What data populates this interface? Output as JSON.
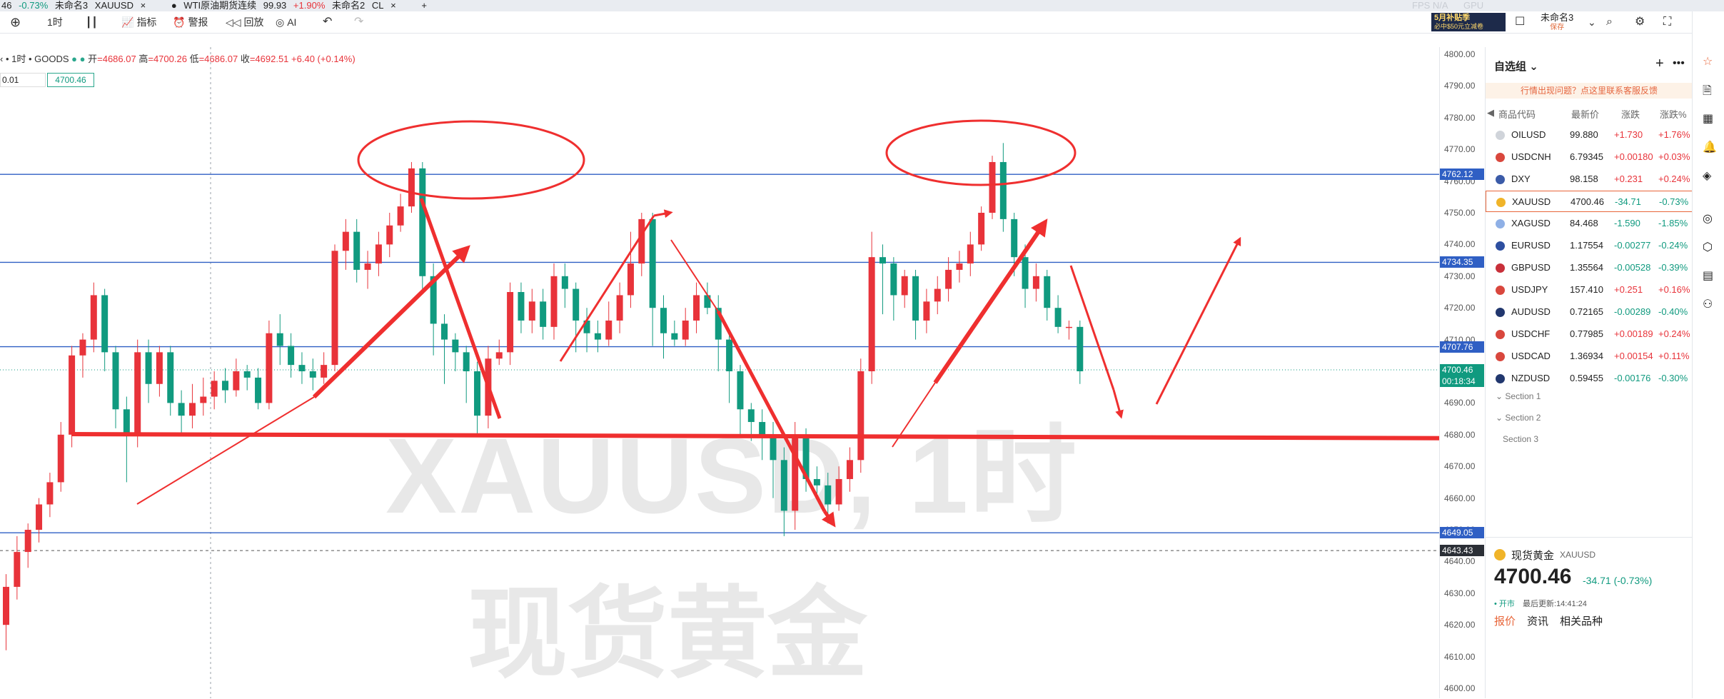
{
  "tabs": [
    {
      "pre": "46",
      "chg": "-0.73%",
      "name": "未命名3",
      "sym": "XAUUSD"
    },
    {
      "name": "WTI原油期货连续",
      "price": "99.93",
      "chg": "+1.90%",
      "ws": "未命名2",
      "sym": "CL"
    }
  ],
  "toolbar": {
    "interval": "1时",
    "indicators": "指标",
    "alert": "警报",
    "replay": "回放",
    "ai": "AI"
  },
  "top_right": {
    "fps": "FPS N/A",
    "gpu": "GPU",
    "layout_name": "未命名3",
    "layout_saved": "保存",
    "promo1": "5月补贴季",
    "promo2": "必中$50元立减卷"
  },
  "symbol_info": {
    "label": "‹ • 1时 • GOODS",
    "open_label": "开",
    "open": "=4686.07",
    "high_label": "高",
    "high": "=4700.26",
    "low_label": "低",
    "low": "=4686.07",
    "close_label": "收",
    "close": "=4692.51",
    "change": "+6.40 (+0.14%)",
    "field1": "0.01",
    "field2": "4700.46"
  },
  "chart_data": {
    "type": "candlestick",
    "title": "XAUUSD, 1时",
    "ylim": [
      4600,
      4800
    ],
    "yticks": [
      4600,
      4610,
      4620,
      4630,
      4640,
      4650,
      4660,
      4670,
      4680,
      4690,
      4700,
      4710,
      4720,
      4730,
      4740,
      4750,
      4760,
      4770,
      4780,
      4790,
      4800
    ],
    "hlines": [
      4762.12,
      4734.35,
      4707.76,
      4649.05
    ],
    "crosshair_price": "4643.43",
    "current_price": "4700.46",
    "countdown": "00:18:34",
    "candles": [
      {
        "o": 4620,
        "c": 4632,
        "h": 4636,
        "l": 4612
      },
      {
        "o": 4632,
        "c": 4643,
        "h": 4648,
        "l": 4628
      },
      {
        "o": 4643,
        "c": 4650,
        "h": 4652,
        "l": 4638
      },
      {
        "o": 4650,
        "c": 4658,
        "h": 4660,
        "l": 4646
      },
      {
        "o": 4658,
        "c": 4665,
        "h": 4668,
        "l": 4654
      },
      {
        "o": 4665,
        "c": 4680,
        "h": 4684,
        "l": 4662
      },
      {
        "o": 4680,
        "c": 4705,
        "h": 4708,
        "l": 4676
      },
      {
        "o": 4705,
        "c": 4710,
        "h": 4712,
        "l": 4698
      },
      {
        "o": 4710,
        "c": 4724,
        "h": 4728,
        "l": 4706
      },
      {
        "o": 4724,
        "c": 4706,
        "h": 4726,
        "l": 4700
      },
      {
        "o": 4706,
        "c": 4688,
        "h": 4708,
        "l": 4682
      },
      {
        "o": 4688,
        "c": 4680,
        "h": 4692,
        "l": 4665
      },
      {
        "o": 4680,
        "c": 4706,
        "h": 4710,
        "l": 4676
      },
      {
        "o": 4706,
        "c": 4696,
        "h": 4710,
        "l": 4690
      },
      {
        "o": 4696,
        "c": 4706,
        "h": 4708,
        "l": 4692
      },
      {
        "o": 4706,
        "c": 4690,
        "h": 4708,
        "l": 4686
      },
      {
        "o": 4690,
        "c": 4686,
        "h": 4694,
        "l": 4680
      },
      {
        "o": 4686,
        "c": 4690,
        "h": 4696,
        "l": 4682
      },
      {
        "o": 4690,
        "c": 4692,
        "h": 4698,
        "l": 4686
      },
      {
        "o": 4692,
        "c": 4697,
        "h": 4700,
        "l": 4688
      },
      {
        "o": 4697,
        "c": 4694,
        "h": 4701,
        "l": 4690
      },
      {
        "o": 4694,
        "c": 4700,
        "h": 4704,
        "l": 4692
      },
      {
        "o": 4700,
        "c": 4698,
        "h": 4702,
        "l": 4694
      },
      {
        "o": 4698,
        "c": 4690,
        "h": 4701,
        "l": 4688
      },
      {
        "o": 4690,
        "c": 4712,
        "h": 4716,
        "l": 4688
      },
      {
        "o": 4712,
        "c": 4708,
        "h": 4718,
        "l": 4702
      },
      {
        "o": 4708,
        "c": 4702,
        "h": 4712,
        "l": 4698
      },
      {
        "o": 4702,
        "c": 4700,
        "h": 4706,
        "l": 4696
      },
      {
        "o": 4700,
        "c": 4698,
        "h": 4704,
        "l": 4694
      },
      {
        "o": 4698,
        "c": 4702,
        "h": 4706,
        "l": 4696
      },
      {
        "o": 4702,
        "c": 4738,
        "h": 4740,
        "l": 4700
      },
      {
        "o": 4738,
        "c": 4744,
        "h": 4748,
        "l": 4732
      },
      {
        "o": 4744,
        "c": 4732,
        "h": 4748,
        "l": 4728
      },
      {
        "o": 4732,
        "c": 4734,
        "h": 4738,
        "l": 4726
      },
      {
        "o": 4734,
        "c": 4740,
        "h": 4744,
        "l": 4730
      },
      {
        "o": 4740,
        "c": 4746,
        "h": 4750,
        "l": 4736
      },
      {
        "o": 4746,
        "c": 4752,
        "h": 4756,
        "l": 4744
      },
      {
        "o": 4752,
        "c": 4764,
        "h": 4766,
        "l": 4750
      },
      {
        "o": 4764,
        "c": 4730,
        "h": 4766,
        "l": 4726
      },
      {
        "o": 4730,
        "c": 4715,
        "h": 4734,
        "l": 4705
      },
      {
        "o": 4715,
        "c": 4710,
        "h": 4718,
        "l": 4696
      },
      {
        "o": 4710,
        "c": 4706,
        "h": 4712,
        "l": 4700
      },
      {
        "o": 4706,
        "c": 4700,
        "h": 4708,
        "l": 4690
      },
      {
        "o": 4700,
        "c": 4686,
        "h": 4703,
        "l": 4680
      },
      {
        "o": 4686,
        "c": 4704,
        "h": 4708,
        "l": 4682
      },
      {
        "o": 4704,
        "c": 4706,
        "h": 4710,
        "l": 4702
      },
      {
        "o": 4706,
        "c": 4725,
        "h": 4728,
        "l": 4702
      },
      {
        "o": 4725,
        "c": 4716,
        "h": 4728,
        "l": 4712
      },
      {
        "o": 4716,
        "c": 4722,
        "h": 4726,
        "l": 4712
      },
      {
        "o": 4722,
        "c": 4714,
        "h": 4726,
        "l": 4710
      },
      {
        "o": 4714,
        "c": 4730,
        "h": 4734,
        "l": 4710
      },
      {
        "o": 4730,
        "c": 4726,
        "h": 4734,
        "l": 4720
      },
      {
        "o": 4726,
        "c": 4716,
        "h": 4728,
        "l": 4706
      },
      {
        "o": 4716,
        "c": 4712,
        "h": 4720,
        "l": 4706
      },
      {
        "o": 4712,
        "c": 4710,
        "h": 4716,
        "l": 4706
      },
      {
        "o": 4710,
        "c": 4716,
        "h": 4722,
        "l": 4708
      },
      {
        "o": 4716,
        "c": 4724,
        "h": 4728,
        "l": 4712
      },
      {
        "o": 4724,
        "c": 4734,
        "h": 4744,
        "l": 4720
      },
      {
        "o": 4734,
        "c": 4748,
        "h": 4750,
        "l": 4730
      },
      {
        "o": 4748,
        "c": 4720,
        "h": 4750,
        "l": 4708
      },
      {
        "o": 4720,
        "c": 4712,
        "h": 4724,
        "l": 4704
      },
      {
        "o": 4712,
        "c": 4710,
        "h": 4716,
        "l": 4708
      },
      {
        "o": 4710,
        "c": 4716,
        "h": 4720,
        "l": 4708
      },
      {
        "o": 4716,
        "c": 4724,
        "h": 4728,
        "l": 4712
      },
      {
        "o": 4724,
        "c": 4720,
        "h": 4728,
        "l": 4718
      },
      {
        "o": 4720,
        "c": 4710,
        "h": 4724,
        "l": 4700
      },
      {
        "o": 4710,
        "c": 4700,
        "h": 4712,
        "l": 4690
      },
      {
        "o": 4700,
        "c": 4688,
        "h": 4702,
        "l": 4680
      },
      {
        "o": 4688,
        "c": 4684,
        "h": 4690,
        "l": 4678
      },
      {
        "o": 4684,
        "c": 4680,
        "h": 4688,
        "l": 4672
      },
      {
        "o": 4680,
        "c": 4672,
        "h": 4684,
        "l": 4660
      },
      {
        "o": 4672,
        "c": 4656,
        "h": 4676,
        "l": 4648
      },
      {
        "o": 4656,
        "c": 4680,
        "h": 4684,
        "l": 4650
      },
      {
        "o": 4680,
        "c": 4666,
        "h": 4682,
        "l": 4662
      },
      {
        "o": 4666,
        "c": 4664,
        "h": 4670,
        "l": 4660
      },
      {
        "o": 4664,
        "c": 4658,
        "h": 4668,
        "l": 4652
      },
      {
        "o": 4658,
        "c": 4666,
        "h": 4670,
        "l": 4656
      },
      {
        "o": 4666,
        "c": 4672,
        "h": 4676,
        "l": 4662
      },
      {
        "o": 4672,
        "c": 4700,
        "h": 4704,
        "l": 4668
      },
      {
        "o": 4700,
        "c": 4736,
        "h": 4744,
        "l": 4696
      },
      {
        "o": 4736,
        "c": 4734,
        "h": 4740,
        "l": 4718
      },
      {
        "o": 4734,
        "c": 4724,
        "h": 4736,
        "l": 4716
      },
      {
        "o": 4724,
        "c": 4730,
        "h": 4732,
        "l": 4720
      },
      {
        "o": 4730,
        "c": 4716,
        "h": 4732,
        "l": 4710
      },
      {
        "o": 4716,
        "c": 4722,
        "h": 4726,
        "l": 4712
      },
      {
        "o": 4722,
        "c": 4726,
        "h": 4730,
        "l": 4718
      },
      {
        "o": 4726,
        "c": 4732,
        "h": 4736,
        "l": 4722
      },
      {
        "o": 4732,
        "c": 4734,
        "h": 4738,
        "l": 4728
      },
      {
        "o": 4734,
        "c": 4740,
        "h": 4744,
        "l": 4730
      },
      {
        "o": 4740,
        "c": 4750,
        "h": 4752,
        "l": 4738
      },
      {
        "o": 4750,
        "c": 4766,
        "h": 4768,
        "l": 4748
      },
      {
        "o": 4766,
        "c": 4748,
        "h": 4772,
        "l": 4744
      },
      {
        "o": 4748,
        "c": 4736,
        "h": 4750,
        "l": 4730
      },
      {
        "o": 4736,
        "c": 4726,
        "h": 4740,
        "l": 4720
      },
      {
        "o": 4726,
        "c": 4730,
        "h": 4734,
        "l": 4722
      },
      {
        "o": 4730,
        "c": 4720,
        "h": 4732,
        "l": 4716
      },
      {
        "o": 4720,
        "c": 4714,
        "h": 4724,
        "l": 4712
      },
      {
        "o": 4714,
        "c": 4714,
        "h": 4716,
        "l": 4710
      },
      {
        "o": 4714,
        "c": 4700,
        "h": 4716,
        "l": 4696
      }
    ]
  },
  "watchlist": {
    "title": "自选组",
    "notice": "行情出现问题？点这里联系客服反馈",
    "cols": [
      "商品代码",
      "最新价",
      "涨跌",
      "涨跌%"
    ],
    "rows": [
      {
        "sym": "OILUSD",
        "last": "99.880",
        "chg": "+1.730",
        "pct": "+1.76%",
        "dir": "up",
        "flag": "#d0d4da"
      },
      {
        "sym": "USDCNH",
        "last": "6.79345",
        "chg": "+0.00180",
        "pct": "+0.03%",
        "dir": "up",
        "flag": "#d9473d"
      },
      {
        "sym": "DXY",
        "last": "98.158",
        "chg": "+0.231",
        "pct": "+0.24%",
        "dir": "up",
        "flag": "#3b5ba8"
      },
      {
        "sym": "XAUUSD",
        "last": "4700.46",
        "chg": "-34.71",
        "pct": "-0.73%",
        "dir": "dn",
        "flag": "#f0b429"
      },
      {
        "sym": "XAGUSD",
        "last": "84.468",
        "chg": "-1.590",
        "pct": "-1.85%",
        "dir": "dn",
        "flag": "#8fb0e6"
      },
      {
        "sym": "EURUSD",
        "last": "1.17554",
        "chg": "-0.00277",
        "pct": "-0.24%",
        "dir": "dn",
        "flag": "#2d4fa0"
      },
      {
        "sym": "GBPUSD",
        "last": "1.35564",
        "chg": "-0.00528",
        "pct": "-0.39%",
        "dir": "dn",
        "flag": "#c8303a"
      },
      {
        "sym": "USDJPY",
        "last": "157.410",
        "chg": "+0.251",
        "pct": "+0.16%",
        "dir": "up",
        "flag": "#d9473d"
      },
      {
        "sym": "AUDUSD",
        "last": "0.72165",
        "chg": "-0.00289",
        "pct": "-0.40%",
        "dir": "dn",
        "flag": "#21376e"
      },
      {
        "sym": "USDCHF",
        "last": "0.77985",
        "chg": "+0.00189",
        "pct": "+0.24%",
        "dir": "up",
        "flag": "#d9473d"
      },
      {
        "sym": "USDCAD",
        "last": "1.36934",
        "chg": "+0.00154",
        "pct": "+0.11%",
        "dir": "up",
        "flag": "#d9473d"
      },
      {
        "sym": "NZDUSD",
        "last": "0.59455",
        "chg": "-0.00176",
        "pct": "-0.30%",
        "dir": "dn",
        "flag": "#21376e"
      }
    ],
    "sections": [
      "Section 1",
      "Section 2",
      "Section 3"
    ]
  },
  "detail": {
    "name": "现货黄金",
    "sym": "XAUUSD",
    "price": "4700.46",
    "chg": "-34.71 (-0.73%)",
    "status": "• 开市",
    "updated": "最后更新:14:41:24",
    "tabs": [
      "报价",
      "资讯",
      "相关品种"
    ]
  },
  "colors": {
    "up": "#e8333a",
    "down": "#109a7f",
    "line": "#2f5fc4",
    "annot": "#ef2f2f"
  }
}
